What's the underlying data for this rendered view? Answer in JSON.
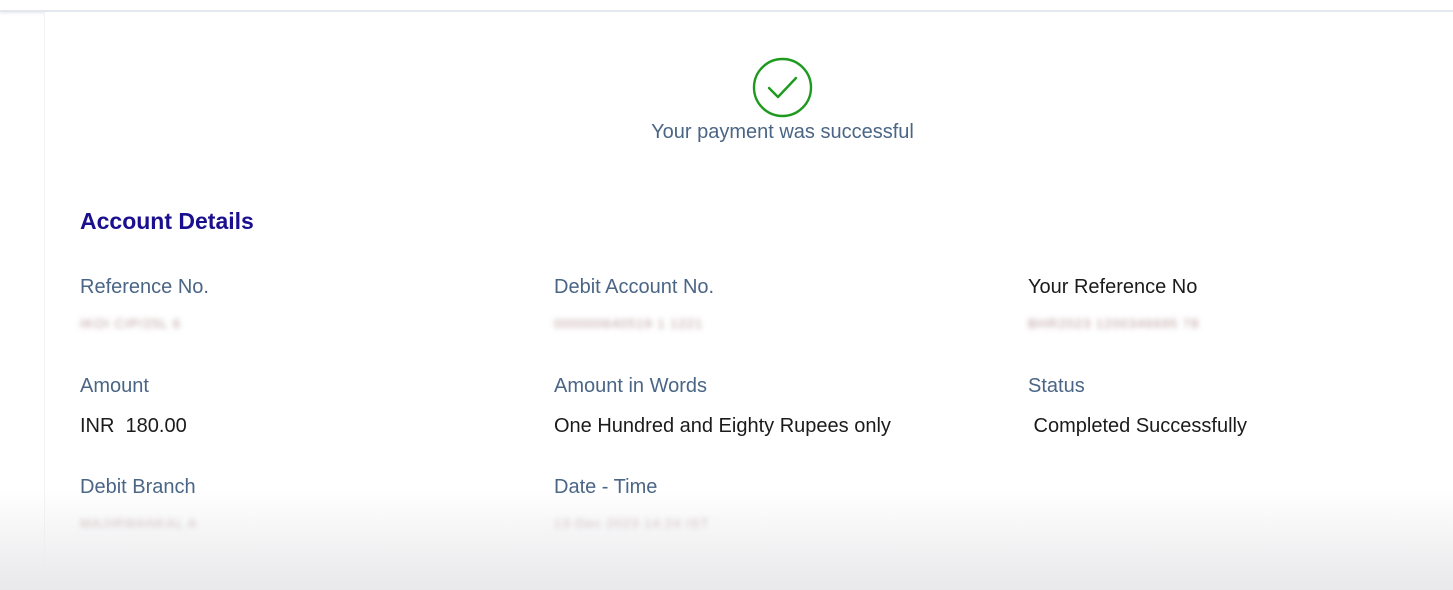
{
  "status_message": "Your payment was successful",
  "section_title": "Account Details",
  "fields": {
    "reference_no": {
      "label": "Reference No.",
      "value": "IKOI CIP/25L 6"
    },
    "debit_account_no": {
      "label": "Debit Account No.",
      "value": "000000640519 1 1221"
    },
    "your_reference_no": {
      "label": "Your Reference No",
      "value": "BHR2023 1200346695 78"
    },
    "amount": {
      "label": "Amount",
      "value": "INR  180.00"
    },
    "amount_in_words": {
      "label": "Amount in Words",
      "value": "One Hundred and Eighty Rupees only"
    },
    "status": {
      "label": "Status",
      "value": " Completed Successfully"
    },
    "debit_branch": {
      "label": "Debit Branch",
      "value": "MAJIRWANKAL A"
    },
    "date_time": {
      "label": "Date - Time",
      "value": "13-Dec 2023 14:24 IST"
    }
  },
  "colors": {
    "success_green": "#1e9a1e",
    "title_navy": "#1a0f8e",
    "label_slate": "#4a6585"
  },
  "icons": {
    "success": "check-circle-icon"
  }
}
